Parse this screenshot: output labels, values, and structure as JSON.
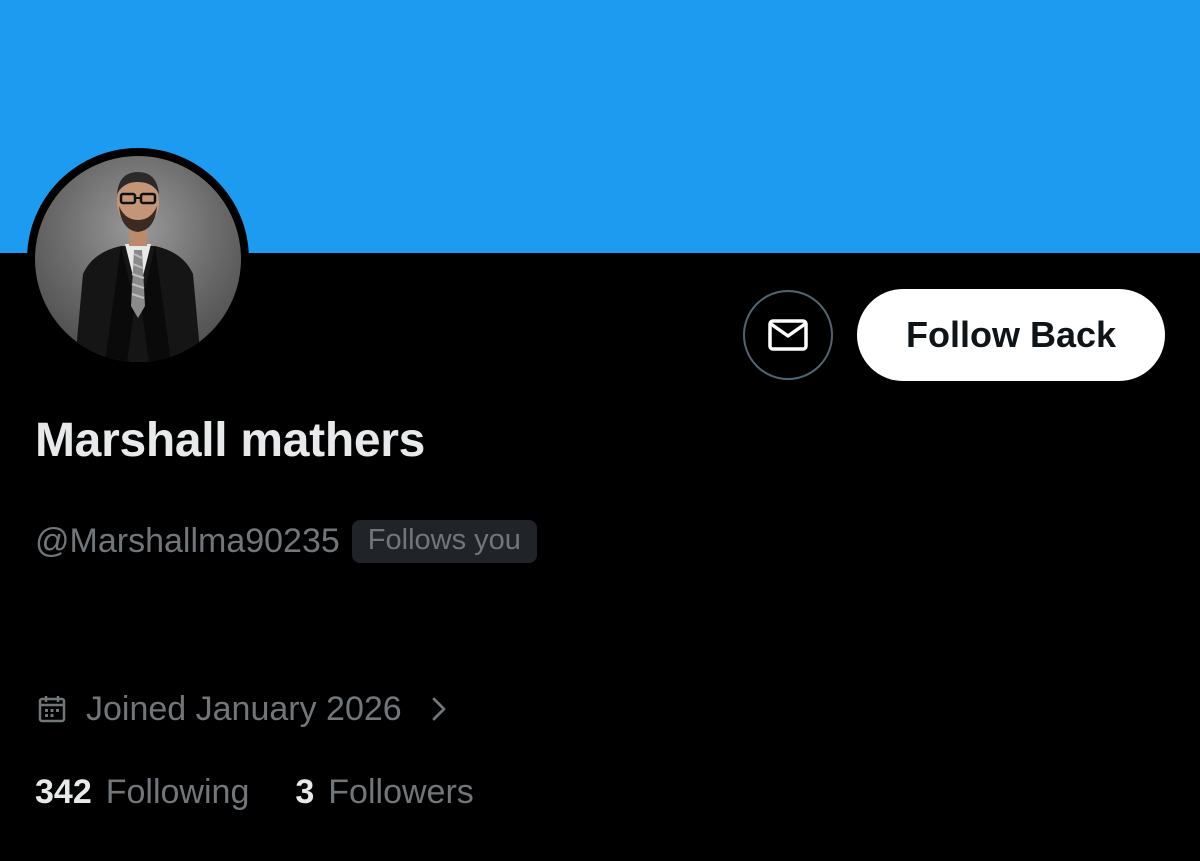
{
  "colors": {
    "banner": "#1d9bf0",
    "background": "#000000",
    "primary_text": "#e7e9ea",
    "secondary_text": "#71767b",
    "button_bg": "#ffffff",
    "button_text": "#0f1419",
    "badge_bg": "#202327",
    "icon_border": "#536471"
  },
  "profile": {
    "avatar_icon": "profile-photo",
    "display_name": "Marshall mathers",
    "handle": "@Marshallma90235",
    "follows_you_badge": "Follows you",
    "joined": {
      "icon": "calendar-icon",
      "text": "Joined January 2026",
      "chevron_icon": "chevron-right-icon"
    },
    "stats": {
      "following_count": "342",
      "following_label": "Following",
      "followers_count": "3",
      "followers_label": "Followers"
    }
  },
  "actions": {
    "message_icon": "mail-icon",
    "follow_back_label": "Follow Back"
  }
}
